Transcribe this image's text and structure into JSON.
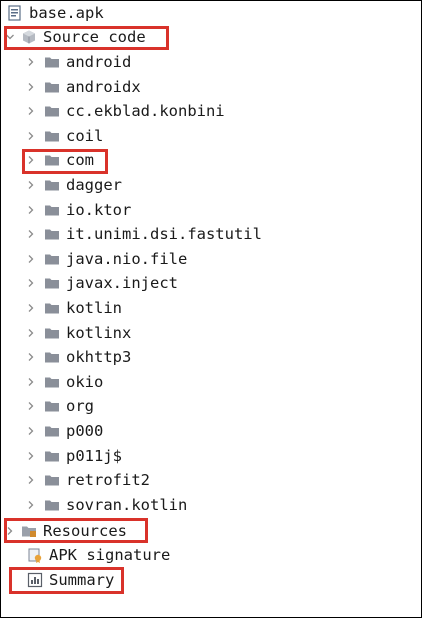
{
  "tree": {
    "root": {
      "label": "base.apk",
      "icon": "apk-file-icon"
    },
    "source_code": {
      "label": "Source code",
      "icon": "package-cube-icon",
      "expanded": true
    },
    "packages": [
      {
        "label": "android"
      },
      {
        "label": "androidx"
      },
      {
        "label": "cc.ekblad.konbini"
      },
      {
        "label": "coil"
      },
      {
        "label": "com"
      },
      {
        "label": "dagger"
      },
      {
        "label": "io.ktor"
      },
      {
        "label": "it.unimi.dsi.fastutil"
      },
      {
        "label": "java.nio.file"
      },
      {
        "label": "javax.inject"
      },
      {
        "label": "kotlin"
      },
      {
        "label": "kotlinx"
      },
      {
        "label": "okhttp3"
      },
      {
        "label": "okio"
      },
      {
        "label": "org"
      },
      {
        "label": "p000"
      },
      {
        "label": "p011j$"
      },
      {
        "label": "retrofit2"
      },
      {
        "label": "sovran.kotlin"
      }
    ],
    "resources": {
      "label": "Resources",
      "icon": "resources-folder-icon"
    },
    "apk_signature": {
      "label": "APK signature",
      "icon": "signature-icon"
    },
    "summary": {
      "label": "Summary",
      "icon": "summary-icon"
    }
  },
  "colors": {
    "highlight": "#d9322a",
    "folder": "#8a8f99",
    "chevron": "#8c8c8c"
  }
}
